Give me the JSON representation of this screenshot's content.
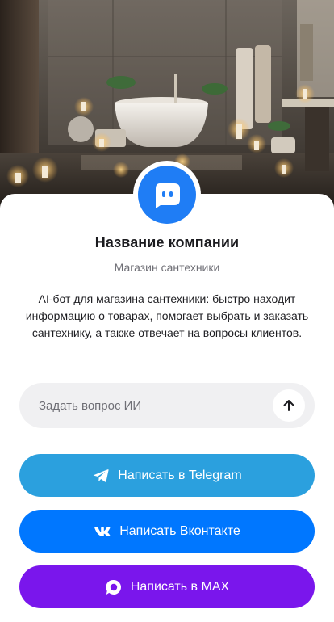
{
  "company": {
    "name": "Название компании",
    "subtitle": "Магазин сантехники",
    "description": "AI-бот для магазина сантехники: быстро находит информацию о товарах, помогает выбрать и заказать сантехнику, а также отвечает на вопросы клиентов."
  },
  "ask": {
    "placeholder": "Задать вопрос ИИ",
    "value": ""
  },
  "buttons": {
    "telegram": "Написать в Telegram",
    "vk": "Написать Вконтакте",
    "max": "Написать в MAX"
  },
  "icons": {
    "hero": "bathroom-photo",
    "avatar": "chat-bot-icon",
    "send": "arrow-up-icon",
    "telegram": "telegram-icon",
    "vk": "vk-icon",
    "max": "max-icon"
  },
  "colors": {
    "avatar": "#1f7df5",
    "telegram": "#2ba0de",
    "vk": "#0077ff",
    "max": "#7a16ec",
    "input_bg": "#f0f0f2",
    "title": "#1b1b1f",
    "muted": "#6f6f76"
  }
}
